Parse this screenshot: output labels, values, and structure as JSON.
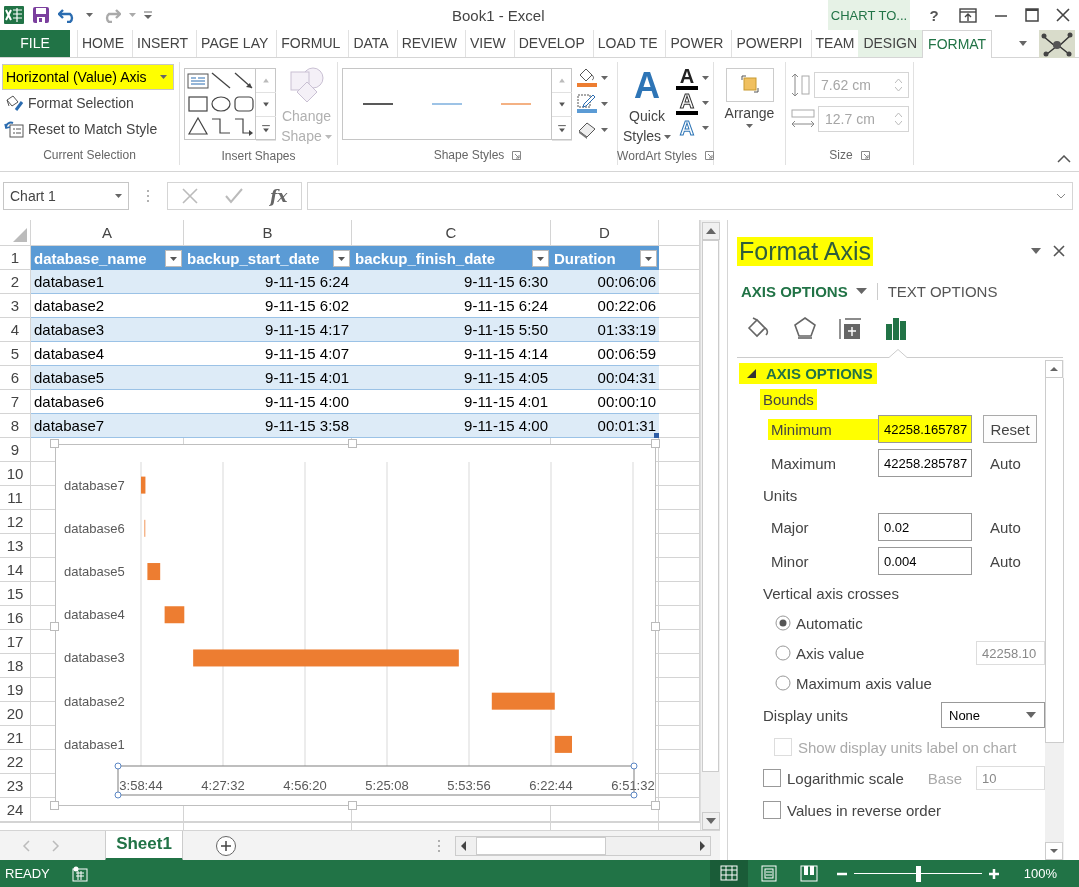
{
  "title_bar": {
    "title": "Book1 - Excel",
    "contextual_group": "CHART TO...",
    "help": "?"
  },
  "ribbon_tabs": [
    {
      "label": "FILE",
      "kind": "file",
      "selected": false
    },
    {
      "label": "HOME",
      "kind": "normal",
      "selected": false
    },
    {
      "label": "INSERT",
      "kind": "normal",
      "selected": false
    },
    {
      "label": "PAGE LAY",
      "kind": "normal",
      "selected": false
    },
    {
      "label": "FORMUL",
      "kind": "normal",
      "selected": false
    },
    {
      "label": "DATA",
      "kind": "normal",
      "selected": false
    },
    {
      "label": "REVIEW",
      "kind": "normal",
      "selected": false
    },
    {
      "label": "VIEW",
      "kind": "normal",
      "selected": false
    },
    {
      "label": "DEVELOP",
      "kind": "normal",
      "selected": false
    },
    {
      "label": "LOAD TE",
      "kind": "normal",
      "selected": false
    },
    {
      "label": "POWER",
      "kind": "normal",
      "selected": false
    },
    {
      "label": "POWERPI",
      "kind": "normal",
      "selected": false
    },
    {
      "label": "TEAM",
      "kind": "normal",
      "selected": false
    },
    {
      "label": "DESIGN",
      "kind": "contextual",
      "selected": false
    },
    {
      "label": "FORMAT",
      "kind": "contextual",
      "selected": true
    }
  ],
  "ribbon": {
    "current_selection": {
      "dropdown": {
        "value": "Horizontal (Value) Axis",
        "highlighted": true
      },
      "buttons": [
        {
          "kind": "format",
          "label": "Format Selection"
        },
        {
          "kind": "reset",
          "label": "Reset to Match Style"
        }
      ],
      "label": "Current Selection"
    },
    "insert_shapes": {
      "change_shape": {
        "label": "Change Shape",
        "disabled": true
      },
      "label": "Insert Shapes"
    },
    "shape_styles": {
      "samples": [
        {
          "color": "#595959"
        },
        {
          "color": "#9dc3e6"
        },
        {
          "color": "#f4b183"
        }
      ],
      "label": "Shape Styles"
    },
    "wordart_styles": {
      "quick_styles": {
        "glyph": "A",
        "label": "Quick Styles"
      },
      "text_buttons": [
        {
          "kind": "fill",
          "glyph": "A"
        },
        {
          "kind": "outline",
          "glyph": "A"
        },
        {
          "kind": "effects",
          "glyph": "A"
        }
      ],
      "label": "WordArt Styles"
    },
    "arrange": {
      "label": "Arrange"
    },
    "size": {
      "fields": [
        {
          "kind": "height",
          "value": "7.62 cm",
          "disabled": true
        },
        {
          "kind": "width",
          "value": "12.7 cm",
          "disabled": true
        }
      ],
      "label": "Size"
    }
  },
  "formula_bar": {
    "name_box": "Chart 1",
    "function_glyph": "fx"
  },
  "sheet": {
    "column_letters": [
      "A",
      "B",
      "C",
      "D"
    ],
    "row_numbers": [
      "1",
      "2",
      "3",
      "4",
      "5",
      "6",
      "7",
      "8",
      "9",
      "10",
      "11",
      "12",
      "13",
      "14",
      "15",
      "16",
      "17",
      "18",
      "19",
      "20",
      "21",
      "22",
      "23",
      "24"
    ],
    "table": {
      "columns": [
        {
          "label": "database_name"
        },
        {
          "label": "backup_start_date"
        },
        {
          "label": "backup_finish_date"
        },
        {
          "label": "Duration"
        }
      ],
      "rows": [
        [
          "database1",
          "9-11-15 6:24",
          "9-11-15 6:30",
          "00:06:06"
        ],
        [
          "database2",
          "9-11-15 6:02",
          "9-11-15 6:24",
          "00:22:06"
        ],
        [
          "database3",
          "9-11-15 4:17",
          "9-11-15 5:50",
          "01:33:19"
        ],
        [
          "database4",
          "9-11-15 4:07",
          "9-11-15 4:14",
          "00:06:59"
        ],
        [
          "database5",
          "9-11-15 4:01",
          "9-11-15 4:05",
          "00:04:31"
        ],
        [
          "database6",
          "9-11-15 4:00",
          "9-11-15 4:01",
          "00:00:10"
        ],
        [
          "database7",
          "9-11-15 3:58",
          "9-11-15 4:00",
          "00:01:31"
        ]
      ]
    }
  },
  "chart": {
    "category_labels": [
      "database7",
      "database6",
      "database5",
      "database4",
      "database3",
      "database2",
      "database1"
    ],
    "axis_labels": [
      "3:58:44",
      "4:27:32",
      "4:56:20",
      "5:25:08",
      "5:53:56",
      "6:22:44",
      "6:51:32"
    ]
  },
  "sheet_tabs": [
    {
      "label": "Sheet1",
      "selected": true
    }
  ],
  "status_bar": {
    "mode": "READY",
    "views": [
      {
        "kind": "normal",
        "selected": true
      },
      {
        "kind": "page_layout",
        "selected": false
      },
      {
        "kind": "page_break",
        "selected": false
      }
    ],
    "zoom": {
      "level": 0.5
    },
    "zoom_text": "100%"
  },
  "pane": {
    "title": {
      "text": "Format Axis",
      "highlighted": true
    },
    "tabs": [
      {
        "label": "AXIS OPTIONS",
        "selected": true
      },
      {
        "label": "TEXT OPTIONS",
        "selected": false
      }
    ],
    "icon_tabs": [
      {
        "kind": "fill_line",
        "selected": false
      },
      {
        "kind": "effects",
        "selected": false
      },
      {
        "kind": "size_properties",
        "selected": false
      },
      {
        "kind": "axis_options",
        "selected": true
      }
    ],
    "section": {
      "title": "AXIS OPTIONS",
      "expanded": true,
      "highlighted": true
    },
    "bounds_heading": {
      "text": "Bounds",
      "highlighted": true
    },
    "bounds": [
      {
        "label": "Minimum",
        "value": "42258.165787",
        "highlighted": true,
        "kind": "button",
        "action": "Reset"
      },
      {
        "label": "Maximum",
        "value": "42258.285787",
        "highlighted": false,
        "kind": "text",
        "action": "Auto"
      }
    ],
    "units_heading": "Units",
    "units": [
      {
        "label": "Major",
        "value": "0.02",
        "highlighted": false,
        "kind": "text",
        "action": "Auto"
      },
      {
        "label": "Minor",
        "value": "0.004",
        "highlighted": false,
        "kind": "text",
        "action": "Auto"
      }
    ],
    "crosses_heading": "Vertical axis crosses",
    "crosses_options": [
      {
        "label": "Automatic",
        "selected": true
      },
      {
        "label": "Axis value",
        "selected": false,
        "value": "42258.10"
      },
      {
        "label": "Maximum axis value",
        "selected": false
      }
    ],
    "display_units": {
      "label": "Display units",
      "value": "None",
      "show_label": {
        "label": "Show display units label on chart",
        "checked": false,
        "disabled": true
      }
    },
    "checkboxes": [
      {
        "label": "Logarithmic scale",
        "checked": false,
        "disabled": false,
        "base_label": "Base",
        "base_value": "10"
      },
      {
        "label": "Values in reverse order",
        "checked": false,
        "disabled": false
      }
    ]
  }
}
